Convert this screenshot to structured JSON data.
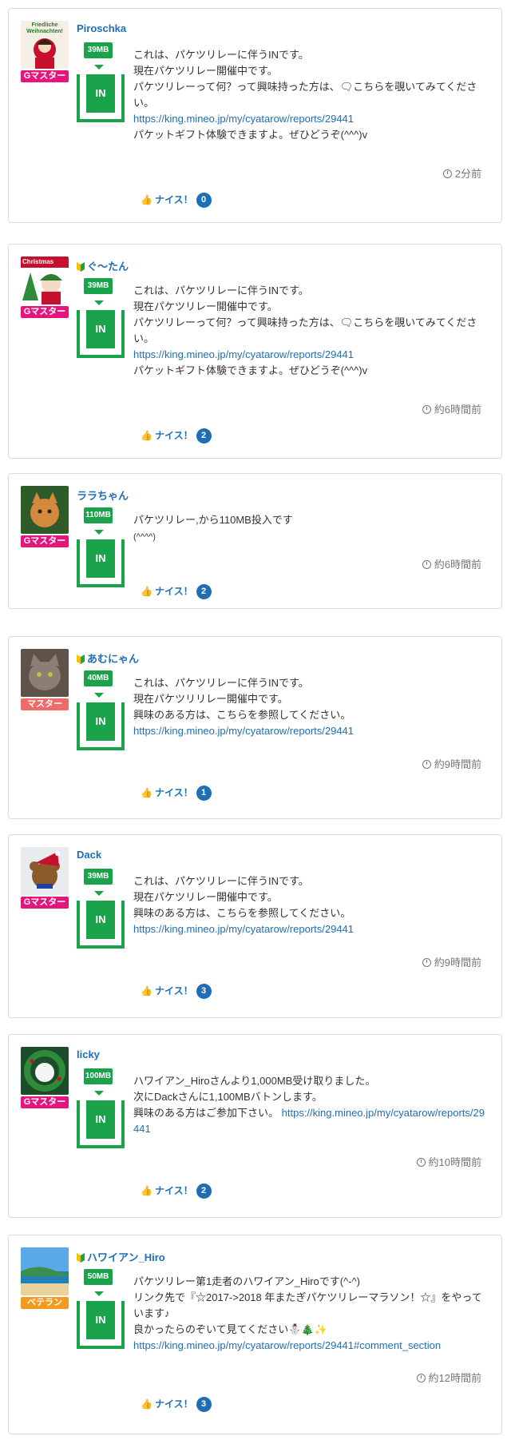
{
  "posts": [
    {
      "username": "Piroschka",
      "beginner": false,
      "avatar_label": "Friedliche Weihnachten!",
      "rank": "Gマスター",
      "mb": "39MB",
      "in_label": "IN",
      "message_lines": [
        "これは、パケツリレーに伴うINです。",
        "現在パケツリレー開催中です。",
        "パケツリレーって何？って興味持った方は、🗨こちらを覗いてみてください。"
      ],
      "link": "https://king.mineo.jp/my/cyatarow/reports/29441",
      "message_after": "パケットギフト体験できますよ。ぜひどうぞ(^^^)v",
      "time": "2分前",
      "nice_label": "ナイス！",
      "nice_count": "0"
    },
    {
      "username": "ぐ〜たん",
      "beginner": true,
      "avatar_label": "Christmas",
      "rank": "Gマスター",
      "mb": "39MB",
      "in_label": "IN",
      "message_lines": [
        "これは、パケツリレーに伴うINです。",
        "現在パケツリレー開催中です。",
        "パケツリレーって何？って興味持った方は、🗨こちらを覗いてみてください。"
      ],
      "link": "https://king.mineo.jp/my/cyatarow/reports/29441",
      "message_after": "パケットギフト体験できますよ。ぜひどうぞ(^^^)v",
      "time": "約6時間前",
      "nice_label": "ナイス！",
      "nice_count": "2"
    },
    {
      "username": "ララちゃん",
      "beginner": false,
      "avatar_label": "",
      "rank": "Gマスター",
      "mb": "110MB",
      "in_label": "IN",
      "message_lines": [
        "パケツリレー,から110MB投入です",
        "(^^^^)"
      ],
      "link": "",
      "message_after": "",
      "time": "約6時間前",
      "nice_label": "ナイス！",
      "nice_count": "2"
    },
    {
      "username": "あむにゃん",
      "beginner": true,
      "avatar_label": "",
      "rank": "マスター",
      "mb": "40MB",
      "in_label": "IN",
      "message_lines": [
        "これは、パケツリレーに伴うINです。",
        "現在パケツリリレー開催中です。",
        "興味のある方は、こちらを参照してください。"
      ],
      "link": "https://king.mineo.jp/my/cyatarow/reports/29441",
      "message_after": "",
      "time": "約9時間前",
      "nice_label": "ナイス！",
      "nice_count": "1"
    },
    {
      "username": "Dack",
      "beginner": false,
      "avatar_label": "",
      "rank": "Gマスター",
      "mb": "39MB",
      "in_label": "IN",
      "message_lines": [
        "これは、パケツリレーに伴うINです。",
        "現在パケツリレー開催中です。",
        "興味のある方は、こちらを参照してください。"
      ],
      "link": "https://king.mineo.jp/my/cyatarow/reports/29441",
      "message_after": "",
      "time": "約9時間前",
      "nice_label": "ナイス！",
      "nice_count": "3"
    },
    {
      "username": "licky",
      "beginner": false,
      "avatar_label": "",
      "rank": "Gマスター",
      "mb": "100MB",
      "in_label": "IN",
      "message_lines": [
        "ハワイアン_Hiroさんより1,000MB受け取りました。",
        "次にDackさんに1,100MBバトンします。",
        "興味のある方はご参加下さい。"
      ],
      "link": "https://king.mineo.jp/my/cyatarow/reports/29441",
      "message_after": "",
      "time": "約10時間前",
      "nice_label": "ナイス！",
      "nice_count": "2"
    },
    {
      "username": "ハワイアン_Hiro",
      "beginner": true,
      "avatar_label": "",
      "rank": "ベテラン",
      "mb": "50MB",
      "in_label": "IN",
      "message_lines": [
        "パケツリレー第1走者のハワイアン_Hiroです(^-^)",
        "リンク先で『☆2017->2018 年またぎパケツリレーマラソン！☆』をやっています♪",
        "良かったらのぞいて見てください⛄🎄✨"
      ],
      "link": "https://king.mineo.jp/my/cyatarow/reports/29441#comment_section",
      "message_after": "",
      "time": "約12時間前",
      "nice_label": "ナイス！",
      "nice_count": "3"
    }
  ],
  "colors": {
    "link": "#1f6eb5",
    "green": "#1aa34a",
    "gmaster": "#e6157e",
    "master": "#f06a6a",
    "veteran": "#f29a1d"
  }
}
